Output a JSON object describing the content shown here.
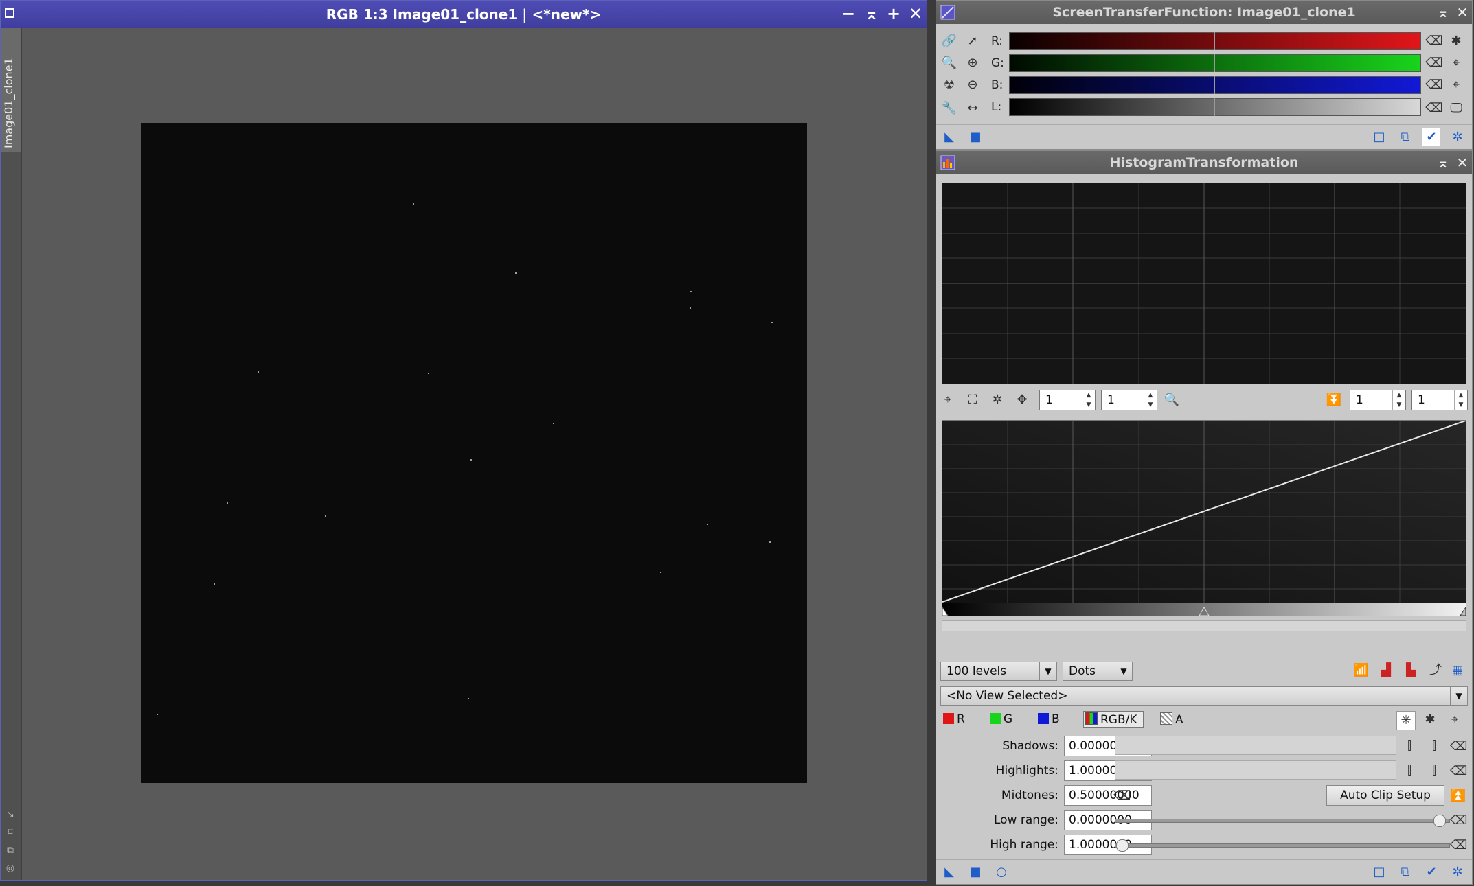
{
  "image_window": {
    "title": "RGB 1:3 Image01_clone1 | <*new*>",
    "side_tab_label": "Image01_clone1",
    "buttons": {
      "minimize": "−",
      "shade": "⌅",
      "maximize": "+",
      "close": "✕"
    }
  },
  "stf_panel": {
    "title": "ScreenTransferFunction: Image01_clone1",
    "channels": [
      {
        "label": "R:",
        "color": "#e0161a"
      },
      {
        "label": "G:",
        "color": "#19d41b"
      },
      {
        "label": "B:",
        "color": "#1219d6"
      },
      {
        "label": "L:",
        "color": "#d8d8d8"
      }
    ]
  },
  "ht_panel": {
    "title": "HistogramTransformation",
    "zoom_h": "1",
    "zoom_v": "1",
    "zoom_h2": "1",
    "zoom_v2": "1",
    "levels": "100 levels",
    "graph_style": "Dots",
    "view": "<No View Selected>",
    "channels": [
      {
        "label": "R",
        "color": "#e01515"
      },
      {
        "label": "G",
        "color": "#19d41b"
      },
      {
        "label": "B",
        "color": "#1219d6"
      },
      {
        "label": "RGB/K",
        "color": "#888888"
      },
      {
        "label": "A",
        "color": "#bbbbbb"
      }
    ],
    "shadows_label": "Shadows:",
    "shadows": "0.00000000",
    "highlights_label": "Highlights:",
    "highlights": "1.00000000",
    "midtones_label": "Midtones:",
    "midtones": "0.50000000",
    "auto_clip": "Auto Clip Setup",
    "low_range_label": "Low range:",
    "low_range": "0.0000000",
    "high_range_label": "High range:",
    "high_range": "1.0000000"
  }
}
